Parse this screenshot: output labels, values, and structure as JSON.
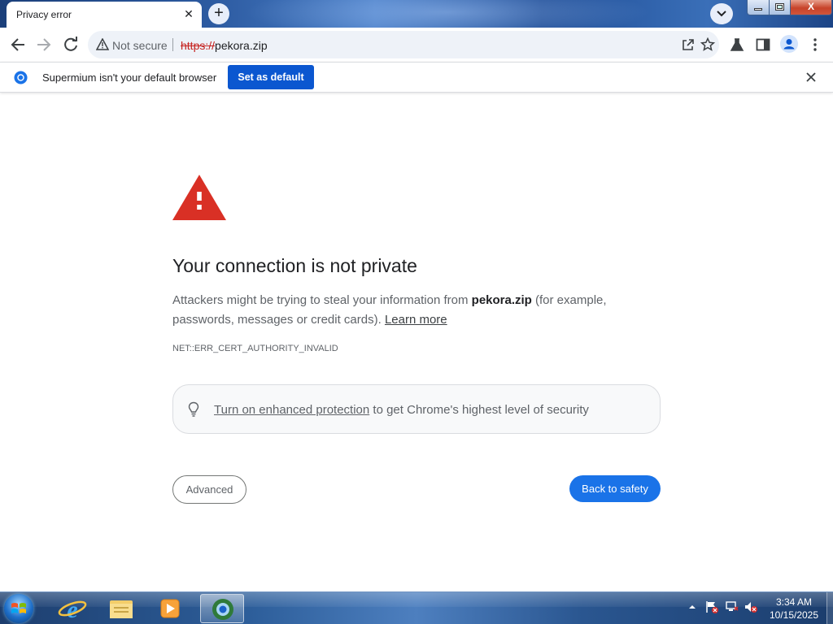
{
  "tab": {
    "title": "Privacy error",
    "close": "✕"
  },
  "new_tab": "+",
  "window": {
    "close_label": "X"
  },
  "omnibox": {
    "security_label": "Not secure",
    "url_scheme": "https://",
    "url_rest": "pekora.zip"
  },
  "infobar": {
    "message": "Supermium isn't your default browser",
    "button": "Set as default"
  },
  "page": {
    "heading": "Your connection is not private",
    "para_before": "Attackers might be trying to steal your information from ",
    "para_domain": "pekora.zip",
    "para_after": " (for example, passwords, messages or credit cards). ",
    "learn_more": "Learn more",
    "error_code": "NET::ERR_CERT_AUTHORITY_INVALID",
    "enhanced_link": "Turn on enhanced protection",
    "enhanced_rest": " to get Chrome's highest level of security",
    "advanced_button": "Advanced",
    "back_button": "Back to safety"
  },
  "taskbar": {
    "time": "3:34 AM",
    "date": "10/15/2025",
    "apps": [
      "internet-explorer-icon",
      "file-explorer-icon",
      "media-player-icon",
      "supermium-browser-icon"
    ]
  },
  "colors": {
    "primary_button": "#1a73e8",
    "infobar_button": "#0b57d0",
    "warning_red": "#d93025",
    "url_scheme_red": "#c5221f"
  }
}
